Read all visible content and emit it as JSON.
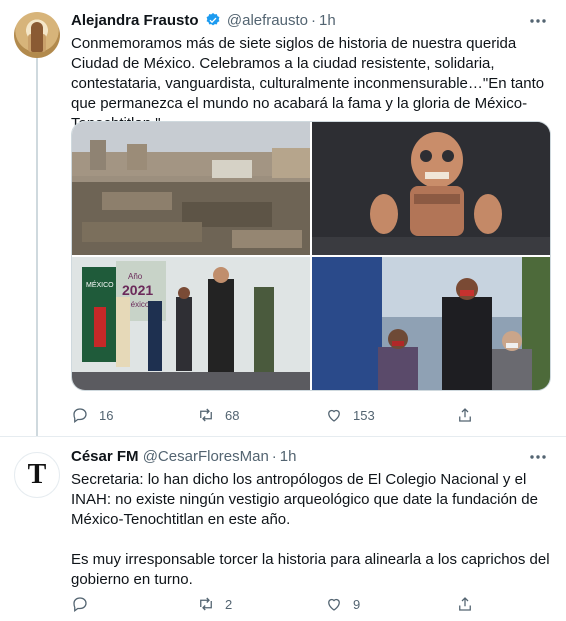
{
  "tweets": [
    {
      "author": "Alejandra Frausto",
      "handle": "@alefrausto",
      "separator": "·",
      "time": "1h",
      "verified": true,
      "text": "Conmemoramos más de siete siglos de historia de nuestra querida Ciudad de México. Celebramos a la ciudad resistente, solidaria, contestataria, vanguardista, culturalmente inconmensurable…\"En tanto que permanezca el mundo no acabará la fama y la gloria de México-Tenochtitlan.\"",
      "media": {
        "banner_text_1": "Año",
        "banner_text_2": "2021",
        "banner_text_3": "México",
        "sign_text": "MÉXICO"
      },
      "actions": {
        "replies": "16",
        "retweets": "68",
        "likes": "153"
      }
    },
    {
      "author": "César FM",
      "handle": "@CesarFloresMan",
      "separator": "·",
      "time": "1h",
      "avatar_letter": "T",
      "text": "Secretaria: lo han dicho los antropólogos de El Colegio Nacional y el INAH: no existe ningún vestigio arqueológico que date la fundación de México-Tenochtitlan en este año.\n\nEs muy irresponsable torcer la historia para alinearla a los caprichos del gobierno en turno.",
      "actions": {
        "replies": "",
        "retweets": "2",
        "likes": "9"
      }
    }
  ],
  "colors": {
    "text": "#0f1419",
    "muted": "#536471",
    "verified": "#1d9bf0",
    "divider": "#e6ecf0"
  },
  "icons": [
    "verified-badge-icon",
    "more-icon",
    "reply-icon",
    "retweet-icon",
    "like-icon",
    "share-icon"
  ]
}
